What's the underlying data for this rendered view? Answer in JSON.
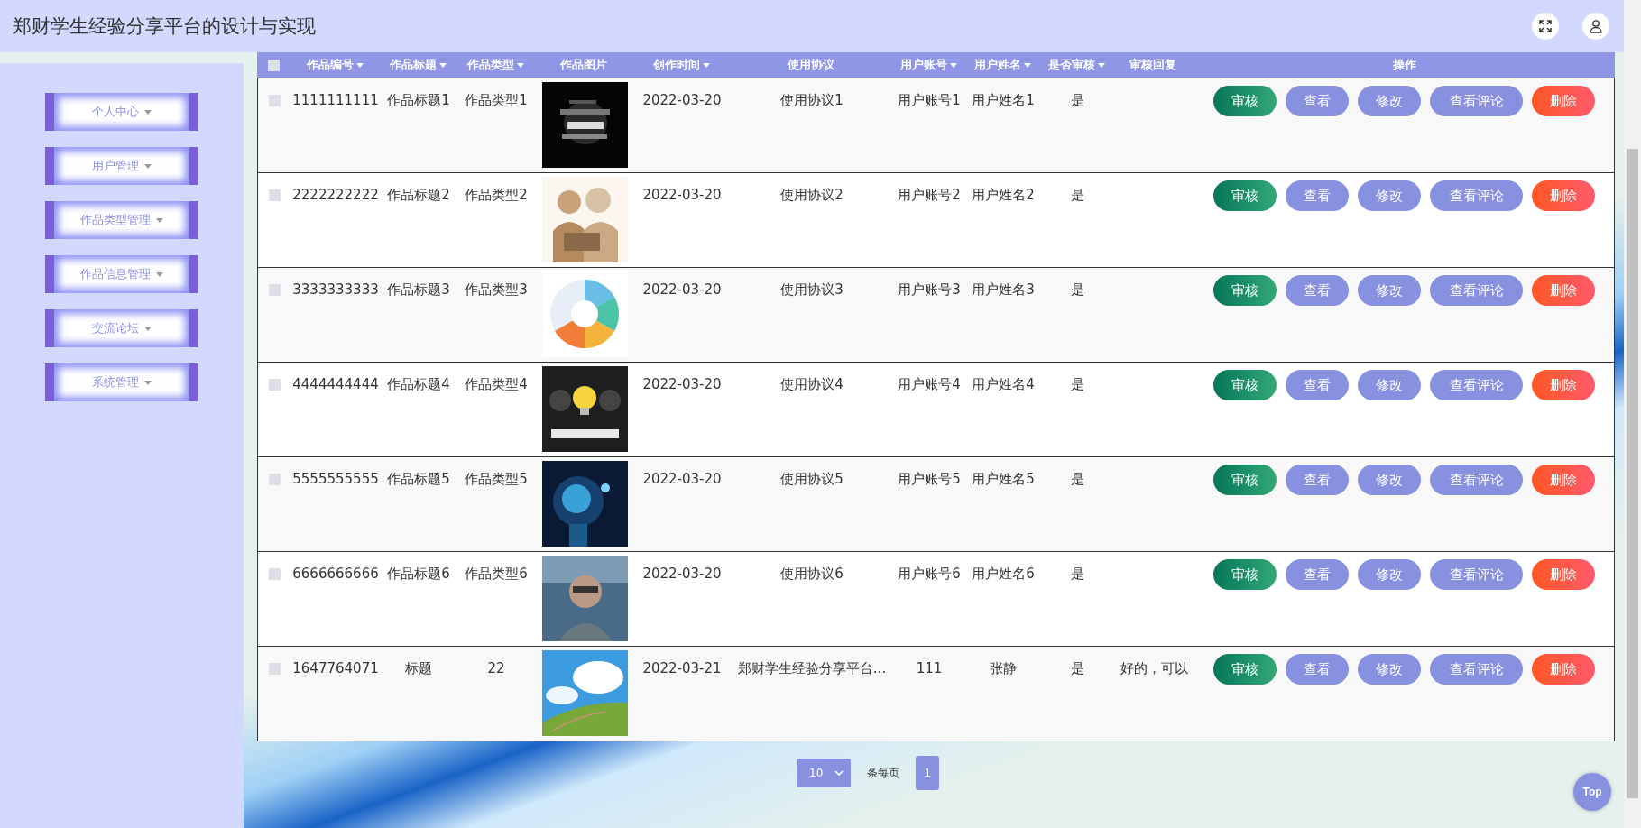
{
  "header": {
    "title": "郑财学生经验分享平台的设计与实现"
  },
  "sidebar": {
    "items": [
      {
        "label": "个人中心"
      },
      {
        "label": "用户管理"
      },
      {
        "label": "作品类型管理"
      },
      {
        "label": "作品信息管理"
      },
      {
        "label": "交流论坛"
      },
      {
        "label": "系统管理"
      }
    ]
  },
  "table": {
    "select_all": {
      "checked": false
    },
    "columns": [
      {
        "label": "作品编号",
        "sortable": true
      },
      {
        "label": "作品标题",
        "sortable": true
      },
      {
        "label": "作品类型",
        "sortable": true
      },
      {
        "label": "作品图片",
        "sortable": false
      },
      {
        "label": "创作时间",
        "sortable": true
      },
      {
        "label": "使用协议",
        "sortable": false
      },
      {
        "label": "用户账号",
        "sortable": true
      },
      {
        "label": "用户姓名",
        "sortable": true
      },
      {
        "label": "是否审核",
        "sortable": true
      },
      {
        "label": "审核回复",
        "sortable": false
      },
      {
        "label": "操作",
        "sortable": false
      }
    ],
    "rows": [
      {
        "checked": false,
        "cells": [
          "1111111111",
          "作品标题1",
          "作品类型1",
          {
            "kind": "picture"
          },
          "2022-03-20",
          "使用协议1",
          "用户账号1",
          "用户姓名1",
          "是",
          ""
        ],
        "actions": [
          {
            "label": "审核",
            "kind": "review"
          },
          {
            "label": "查看",
            "kind": "plain"
          },
          {
            "label": "修改",
            "kind": "plain"
          },
          {
            "label": "查看评论",
            "kind": "plain"
          },
          {
            "label": "删除",
            "kind": "danger"
          }
        ]
      },
      {
        "checked": false,
        "cells": [
          "2222222222",
          "作品标题2",
          "作品类型2",
          {
            "kind": "picture"
          },
          "2022-03-20",
          "使用协议2",
          "用户账号2",
          "用户姓名2",
          "是",
          ""
        ],
        "actions": [
          {
            "label": "审核",
            "kind": "review"
          },
          {
            "label": "查看",
            "kind": "plain"
          },
          {
            "label": "修改",
            "kind": "plain"
          },
          {
            "label": "查看评论",
            "kind": "plain"
          },
          {
            "label": "删除",
            "kind": "danger"
          }
        ]
      },
      {
        "checked": false,
        "cells": [
          "3333333333",
          "作品标题3",
          "作品类型3",
          {
            "kind": "picture"
          },
          "2022-03-20",
          "使用协议3",
          "用户账号3",
          "用户姓名3",
          "是",
          ""
        ],
        "actions": [
          {
            "label": "审核",
            "kind": "review"
          },
          {
            "label": "查看",
            "kind": "plain"
          },
          {
            "label": "修改",
            "kind": "plain"
          },
          {
            "label": "查看评论",
            "kind": "plain"
          },
          {
            "label": "删除",
            "kind": "danger"
          }
        ]
      },
      {
        "checked": false,
        "cells": [
          "4444444444",
          "作品标题4",
          "作品类型4",
          {
            "kind": "picture"
          },
          "2022-03-20",
          "使用协议4",
          "用户账号4",
          "用户姓名4",
          "是",
          ""
        ],
        "actions": [
          {
            "label": "审核",
            "kind": "review"
          },
          {
            "label": "查看",
            "kind": "plain"
          },
          {
            "label": "修改",
            "kind": "plain"
          },
          {
            "label": "查看评论",
            "kind": "plain"
          },
          {
            "label": "删除",
            "kind": "danger"
          }
        ]
      },
      {
        "checked": false,
        "cells": [
          "5555555555",
          "作品标题5",
          "作品类型5",
          {
            "kind": "picture"
          },
          "2022-03-20",
          "使用协议5",
          "用户账号5",
          "用户姓名5",
          "是",
          ""
        ],
        "actions": [
          {
            "label": "审核",
            "kind": "review"
          },
          {
            "label": "查看",
            "kind": "plain"
          },
          {
            "label": "修改",
            "kind": "plain"
          },
          {
            "label": "查看评论",
            "kind": "plain"
          },
          {
            "label": "删除",
            "kind": "danger"
          }
        ]
      },
      {
        "checked": false,
        "cells": [
          "6666666666",
          "作品标题6",
          "作品类型6",
          {
            "kind": "picture"
          },
          "2022-03-20",
          "使用协议6",
          "用户账号6",
          "用户姓名6",
          "是",
          ""
        ],
        "actions": [
          {
            "label": "审核",
            "kind": "review"
          },
          {
            "label": "查看",
            "kind": "plain"
          },
          {
            "label": "修改",
            "kind": "plain"
          },
          {
            "label": "查看评论",
            "kind": "plain"
          },
          {
            "label": "删除",
            "kind": "danger"
          }
        ]
      },
      {
        "checked": false,
        "cells": [
          "1647764071",
          "标题",
          "22",
          {
            "kind": "picture"
          },
          "2022-03-21",
          "郑财学生经验分享平台...",
          "111",
          "张静",
          "是",
          "好的，可以"
        ],
        "actions": [
          {
            "label": "审核",
            "kind": "review"
          },
          {
            "label": "查看",
            "kind": "plain"
          },
          {
            "label": "修改",
            "kind": "plain"
          },
          {
            "label": "查看评论",
            "kind": "plain"
          },
          {
            "label": "删除",
            "kind": "danger"
          }
        ]
      }
    ]
  },
  "pagination": {
    "page_size": "10",
    "per_page_label": "条每页",
    "pages": [
      {
        "label": "1",
        "selected": true
      }
    ]
  },
  "top_button": "Top"
}
